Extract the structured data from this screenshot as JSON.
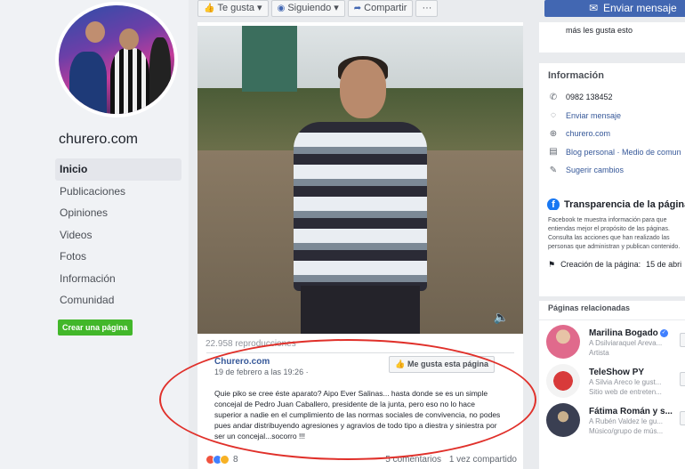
{
  "sidebar": {
    "page_name": "churero.com",
    "nav": [
      "Inicio",
      "Publicaciones",
      "Opiniones",
      "Videos",
      "Fotos",
      "Información",
      "Comunidad"
    ],
    "create_page": "Crear una página"
  },
  "actions": {
    "like": "Te gusta",
    "follow": "Siguiendo",
    "share": "Compartir",
    "more": "···",
    "send_message": "Enviar mensaje"
  },
  "post": {
    "views": "22.958 reproducciones",
    "shared_name": "Churero.com",
    "shared_date": "19 de febrero a las 19:26 ·",
    "like_page": "Me gusta esta página",
    "text": "Quie piko se cree éste aparato? Aipo Ever Salinas... hasta donde se es un simple concejal de Pedro Juan Caballero, presidente de la junta, pero eso no lo hace superior a nadie en el cumplimiento de las normas sociales de convivencia, no podes pues andar distribuyendo agresiones y agravios de todo tipo a diestra y siniestra por ser un concejal...socorro !!!",
    "reaction_count": "8",
    "comments": "5 comentarios",
    "shares": "1 vez compartido"
  },
  "right": {
    "likes_text_1": "más les gusta esto",
    "info_title": "Información",
    "info": [
      {
        "icon": "phone-icon",
        "text": "0982 138452"
      },
      {
        "icon": "messenger-icon",
        "text": "Enviar mensaje"
      },
      {
        "icon": "globe-icon",
        "text": "churero.com"
      },
      {
        "icon": "category-icon",
        "text": "Blog personal · Medio de comun"
      },
      {
        "icon": "pencil-icon",
        "text": "Sugerir cambios"
      }
    ],
    "transparency_title": "Transparencia de la página",
    "transparency_desc": "Facebook te muestra información para que entiendas mejor el propósito de las páginas. Consulta las acciones que han realizado las personas que administran y publican contenido.",
    "creation_label": "Creación de la página:",
    "creation_value": "15 de abri",
    "related_title": "Páginas relacionadas",
    "related": [
      {
        "name": "Marilina Bogado",
        "verified": true,
        "sub1": "A Dsilviaraquel Areva...",
        "sub2": "Artista"
      },
      {
        "name": "TeleShow PY",
        "verified": false,
        "sub1": "A Silvia Areco le gust...",
        "sub2": "Sitio web de entreten..."
      },
      {
        "name": "Fátima Román y s...",
        "verified": false,
        "sub1": "A Rubén Valdez le gu...",
        "sub2": "Músico/grupo de mús..."
      }
    ]
  },
  "colors": {
    "brand_blue": "#4267b2",
    "link_blue": "#365899",
    "annotation_red": "#e0302a",
    "create_green": "#42b72a"
  }
}
